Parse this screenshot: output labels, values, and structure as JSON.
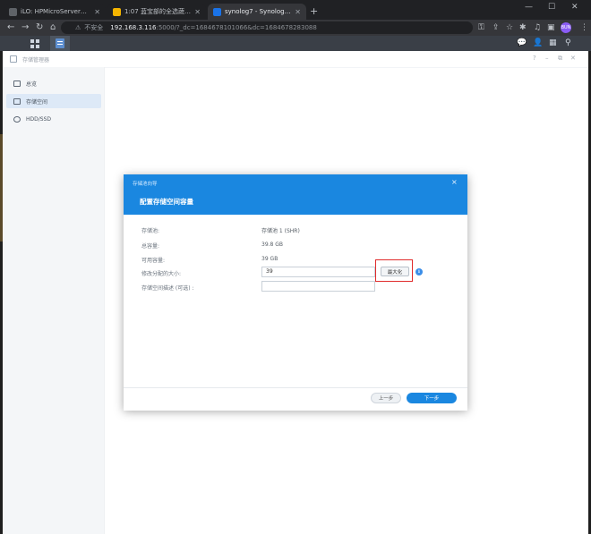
{
  "browser": {
    "tabs": [
      {
        "title": "iLO: HPMicroServerGen8ESXi",
        "active": false,
        "favicon_color": "#5f6368"
      },
      {
        "title": "1:07 蓝宝部的全选蔬对 - HPM...",
        "active": false,
        "favicon_color": "#f4b400"
      },
      {
        "title": "synolog7 - Synology NAS",
        "active": true,
        "favicon_color": "#1a73e8"
      }
    ],
    "new_tab": "+",
    "address": {
      "security": "不安全",
      "host": "192.168.3.116",
      "path": ":5000/?_dc=1684678101066&dc=1684678283088"
    },
    "profile_initials": "BUN"
  },
  "app": {
    "title": "存储管理器",
    "sidebar": [
      {
        "label": "总览",
        "selected": false
      },
      {
        "label": "存储空间",
        "selected": true
      },
      {
        "label": "HDD/SSD",
        "selected": false
      }
    ]
  },
  "dialog": {
    "wizard_title": "存储池向导",
    "close": "×",
    "heading": "配置存储空间容量",
    "rows": [
      {
        "label": "存储池:",
        "value": "存储池 1 (SHR)"
      },
      {
        "label": "总容量:",
        "value": "39.8 GB"
      },
      {
        "label": "可用容量:",
        "value": "39 GB"
      }
    ],
    "size_label": "修改分配的大小:",
    "size_value": "39",
    "max_button": "最大化",
    "info_glyph": "i",
    "description_label": "存储空间描述 (可选) :",
    "description_value": "",
    "prev_button": "上一步",
    "next_button": "下一步"
  },
  "colors": {
    "dialog_header": "#1a87e0",
    "highlight": "#e02b2b",
    "primary_button": "#1a87e0"
  }
}
